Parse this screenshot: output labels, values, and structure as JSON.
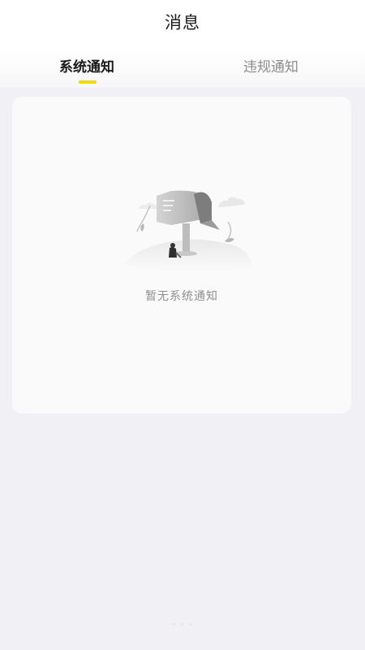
{
  "header": {
    "title": "消息"
  },
  "tabs": [
    {
      "label": "系统通知",
      "active": true
    },
    {
      "label": "违规通知",
      "active": false
    }
  ],
  "colors": {
    "accent": "#f5d800",
    "active_tab_text": "#1b1b1b",
    "inactive_tab_text": "#8c8c8c",
    "background": "#f1f1f5",
    "card": "#fafafa"
  },
  "empty_state": {
    "icon": "empty-mailbox-illustration",
    "message": "暂无系统通知"
  }
}
